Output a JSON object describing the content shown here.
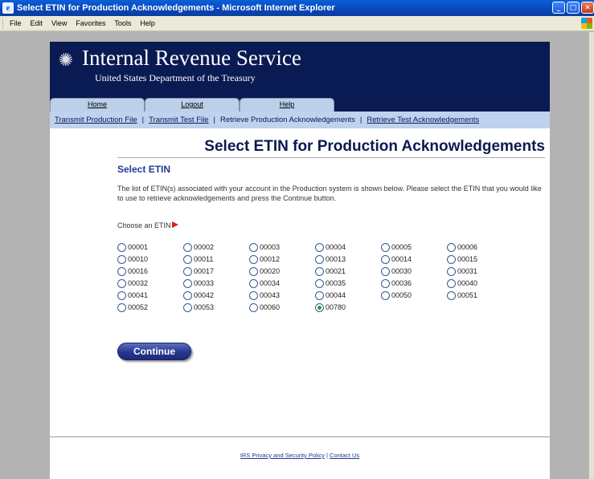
{
  "window": {
    "title": "Select ETIN for Production Acknowledgements - Microsoft Internet Explorer"
  },
  "menubar": [
    "File",
    "Edit",
    "View",
    "Favorites",
    "Tools",
    "Help"
  ],
  "header": {
    "agency": "Internal Revenue Service",
    "department": "United States Department of the Treasury",
    "tabs": [
      "Home",
      "Logout",
      "Help"
    ]
  },
  "subnav": {
    "links": [
      "Transmit Production File",
      "Transmit Test File",
      "Retrieve Production Acknowledgements",
      "Retrieve Test Acknowledgements"
    ]
  },
  "main": {
    "title": "Select ETIN for Production Acknowledgements",
    "section_heading": "Select ETIN",
    "description": "The list of ETIN(s) associated with your account in the Production system is shown below. Please select the ETIN that you would like to use to retrieve acknowledgements and press the Continue button.",
    "choose_label": "Choose an ETIN",
    "etins": [
      "00001",
      "00002",
      "00003",
      "00004",
      "00005",
      "00006",
      "00010",
      "00011",
      "00012",
      "00013",
      "00014",
      "00015",
      "00016",
      "00017",
      "00020",
      "00021",
      "00030",
      "00031",
      "00032",
      "00033",
      "00034",
      "00035",
      "00036",
      "00040",
      "00041",
      "00042",
      "00043",
      "00044",
      "00050",
      "00051",
      "00052",
      "00053",
      "00060",
      "00780"
    ],
    "selected_etin": "00780",
    "continue_label": "Continue"
  },
  "footer": {
    "privacy_link": "IRS Privacy and Security Policy",
    "separator": "|",
    "contact_link": "Contact Us"
  },
  "colors": {
    "header_navy": "#0a1a52",
    "nav_blue": "#bfd2ee",
    "button": "#28378f",
    "arrow": "#d51d1d"
  }
}
